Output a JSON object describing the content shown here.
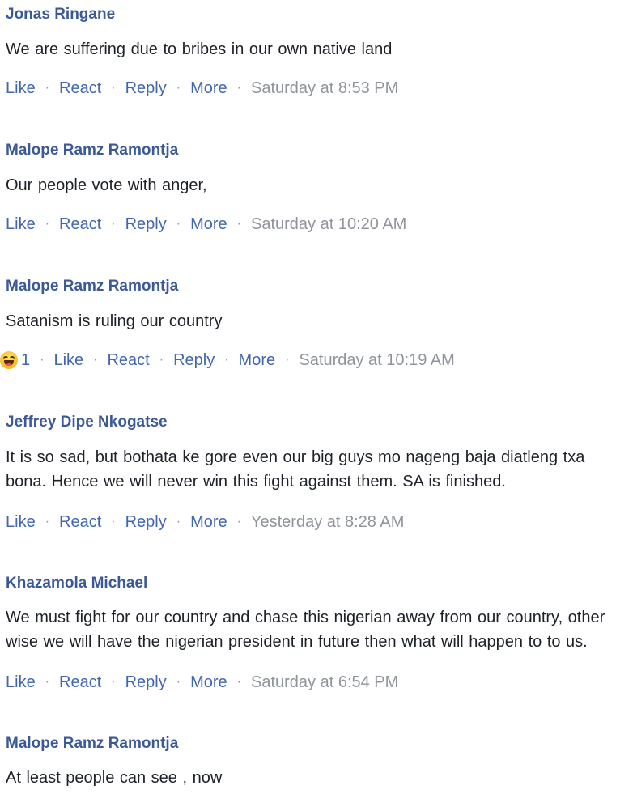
{
  "actions": {
    "like": "Like",
    "react": "React",
    "reply": "Reply",
    "more": "More",
    "separator": "·"
  },
  "comments": [
    {
      "author": "Jonas Ringane",
      "text": "We are suffering due to bribes in our own native land",
      "time": "Saturday at 8:53 PM"
    },
    {
      "author": "Malope Ramz Ramontja",
      "text": "Our people vote with anger,",
      "time": "Saturday at 10:20 AM"
    },
    {
      "author": "Malope Ramz Ramontja",
      "text": "Satanism is ruling our country",
      "time": "Saturday at 10:19 AM",
      "reaction": {
        "icon": "haha-reaction-icon",
        "count": "1"
      }
    },
    {
      "author": "Jeffrey Dipe Nkogatse",
      "text": "It is so sad, but bothata ke gore even our big guys mo nageng baja diatleng txa bona. Hence we will never win this fight against them. SA is finished.",
      "time": "Yesterday at 8:28 AM"
    },
    {
      "author": "Khazamola Michael",
      "text": "We must fight for our country and chase this nigerian away from our country, other wise we will have the nigerian president in future then what will happen to to us.",
      "time": "Saturday at 6:54 PM"
    },
    {
      "author": "Malope Ramz Ramontja",
      "text": "At least people can see , now"
    }
  ]
}
